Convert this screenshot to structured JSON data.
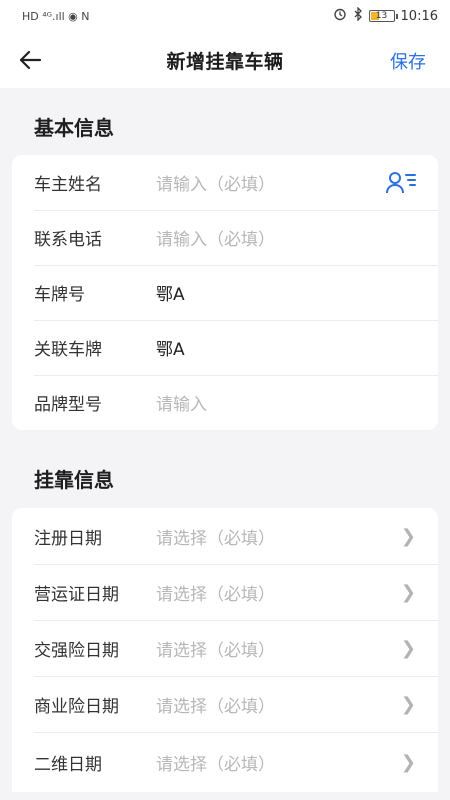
{
  "status_bar": {
    "left_icons": [
      "hd-icon",
      "signal-4g-icon",
      "wifi-icon",
      "nfc-icon"
    ],
    "left_text": "HD ⁴ᴳ.ıll ◉ N",
    "battery_level": "13",
    "time": "10:16"
  },
  "navbar": {
    "title": "新增挂靠车辆",
    "save_label": "保存"
  },
  "basic_section": {
    "title": "基本信息",
    "rows": [
      {
        "label": "车主姓名",
        "value": "请输入（必填）",
        "placeholder": true
      },
      {
        "label": "联系电话",
        "value": "请输入（必填）",
        "placeholder": true
      },
      {
        "label": "车牌号",
        "value": "鄂A",
        "placeholder": false
      },
      {
        "label": "关联车牌",
        "value": "鄂A",
        "placeholder": false
      },
      {
        "label": "品牌型号",
        "value": "请输入",
        "placeholder": true
      }
    ]
  },
  "affiliation_section": {
    "title": "挂靠信息",
    "rows": [
      {
        "label": "注册日期",
        "value": "请选择（必填）",
        "placeholder": true
      },
      {
        "label": "营运证日期",
        "value": "请选择（必填）",
        "placeholder": true
      },
      {
        "label": "交强险日期",
        "value": "请选择（必填）",
        "placeholder": true
      },
      {
        "label": "商业险日期",
        "value": "请选择（必填）",
        "placeholder": true
      },
      {
        "label": "二维日期",
        "value": "请选择（必填）",
        "placeholder": true
      }
    ]
  },
  "colors": {
    "accent": "#2c6fe0",
    "placeholder": "#b7b7b7",
    "background": "#f4f4f6"
  }
}
